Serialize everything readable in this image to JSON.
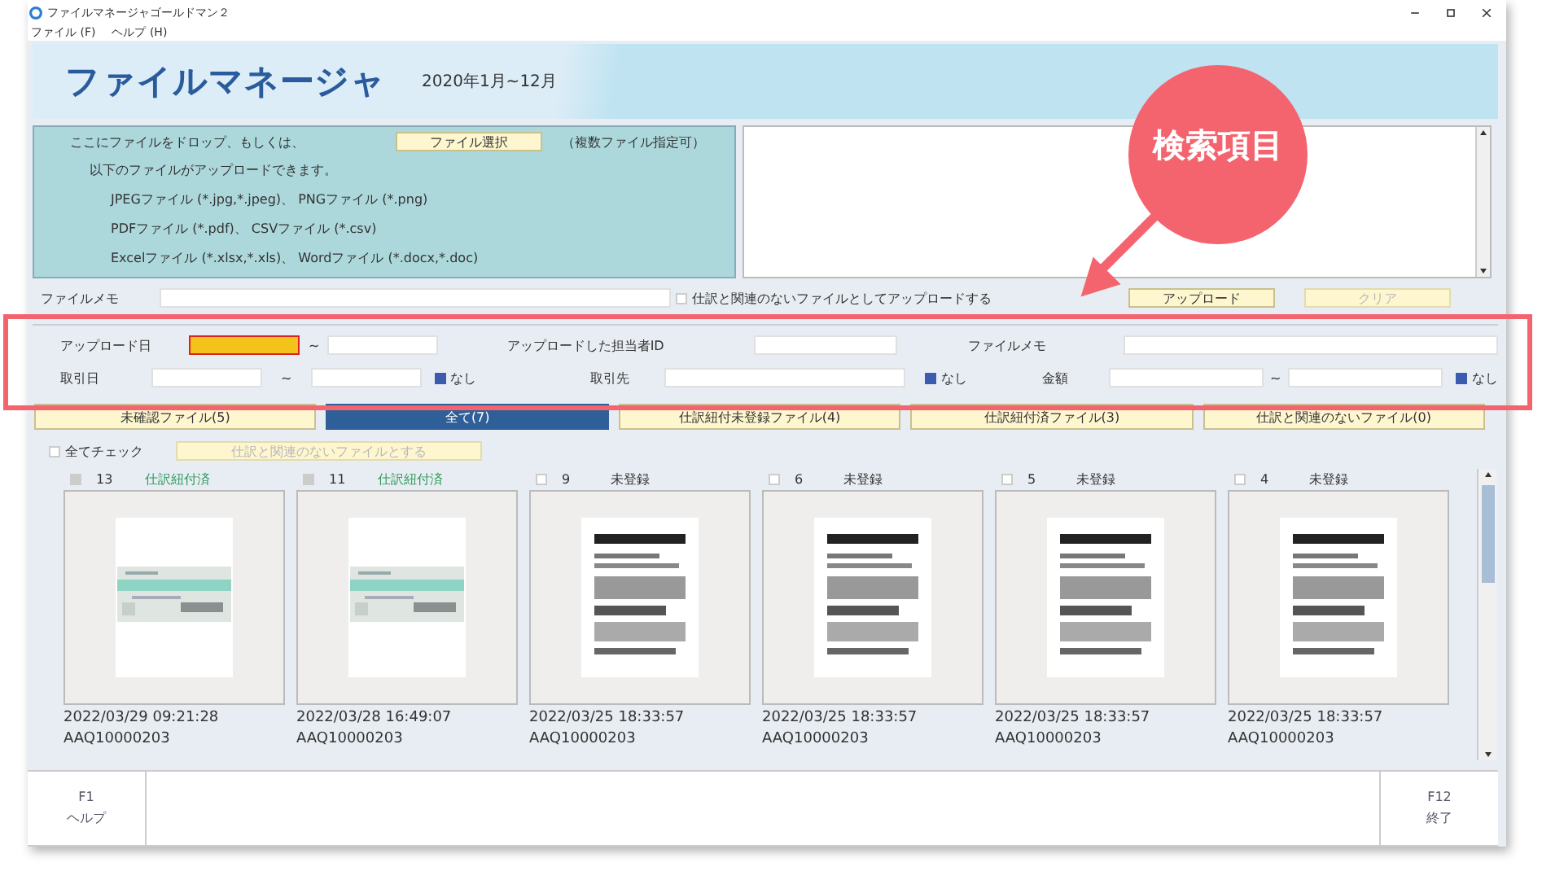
{
  "window": {
    "title": "ファイルマネージャゴールドマン２"
  },
  "menu": [
    "ファイル (F)",
    "ヘルプ (H)"
  ],
  "header": {
    "title": "ファイルマネージャ",
    "period": "2020年1月~12月"
  },
  "upload": {
    "drop_text": "ここにファイルをドロップ、もしくは、",
    "select_button": "ファイル選択",
    "multi_note": "（複数ファイル指定可）",
    "intro": "以下のファイルがアップロードできます。",
    "types": [
      "JPEGファイル (*.jpg,*.jpeg)、 PNGファイル (*.png)",
      "PDFファイル (*.pdf)、 CSVファイル (*.csv)",
      "Excelファイル (*.xlsx,*.xls)、 Wordファイル (*.docx,*.doc)"
    ]
  },
  "memo": {
    "label": "ファイルメモ",
    "unrelated": {
      "label": "仕訳と関連のないファイルとしてアップロードする",
      "checked": false
    },
    "upload_button": {
      "label": "アップロード",
      "disabled": false
    },
    "clear_button": {
      "label": "クリア",
      "disabled": true
    }
  },
  "search": {
    "upload_date": {
      "label": "アップロード日",
      "from_focused": true,
      "tilde": "~"
    },
    "uploader": {
      "label": "アップロードした担当者ID"
    },
    "file_memo": {
      "label": "ファイルメモ"
    },
    "trade_date": {
      "label": "取引日",
      "tilde": "~",
      "none": {
        "label": "なし",
        "checked": true
      }
    },
    "partner": {
      "label": "取引先",
      "none": {
        "label": "なし",
        "checked": true
      }
    },
    "amount": {
      "label": "金額",
      "tilde": "~",
      "none": {
        "label": "なし",
        "checked": true
      }
    }
  },
  "tabs": [
    {
      "label": "未確認ファイル(5)",
      "selected": false
    },
    {
      "label": "全て(7)",
      "selected": true
    },
    {
      "label": "仕訳紐付未登録ファイル(4)",
      "selected": false
    },
    {
      "label": "仕訳紐付済ファイル(3)",
      "selected": false
    },
    {
      "label": "仕訳と関連のないファイル(0)",
      "selected": false
    }
  ],
  "check_all": {
    "label": "全てチェック",
    "checked": false
  },
  "mark_unrelated_button": {
    "label": "仕訳と関連のないファイルとする",
    "disabled": true
  },
  "files": [
    {
      "number": "13",
      "status": "仕訳紐付済",
      "color": "#2e9a5a",
      "disabled": true,
      "kind": "slip",
      "date": "2022/03/29 09:21:28",
      "id": "AAQ10000203"
    },
    {
      "number": "11",
      "status": "仕訳紐付済",
      "color": "#2e9a5a",
      "disabled": true,
      "kind": "slip",
      "date": "2022/03/28 16:49:07",
      "id": "AAQ10000203"
    },
    {
      "number": "9",
      "status": "未登録",
      "color": "#333333",
      "disabled": false,
      "kind": "receipt",
      "date": "2022/03/25 18:33:57",
      "id": "AAQ10000203"
    },
    {
      "number": "6",
      "status": "未登録",
      "color": "#333333",
      "disabled": false,
      "kind": "receipt",
      "date": "2022/03/25 18:33:57",
      "id": "AAQ10000203"
    },
    {
      "number": "5",
      "status": "未登録",
      "color": "#333333",
      "disabled": false,
      "kind": "receipt",
      "date": "2022/03/25 18:33:57",
      "id": "AAQ10000203"
    },
    {
      "number": "4",
      "status": "未登録",
      "color": "#333333",
      "disabled": false,
      "kind": "receipt",
      "date": "2022/03/25 18:33:57",
      "id": "AAQ10000203"
    }
  ],
  "footer": {
    "left": {
      "key": "F1",
      "label": "ヘルプ"
    },
    "right": {
      "key": "F12",
      "label": "終了"
    }
  },
  "annotation": {
    "label": "検索項目"
  }
}
